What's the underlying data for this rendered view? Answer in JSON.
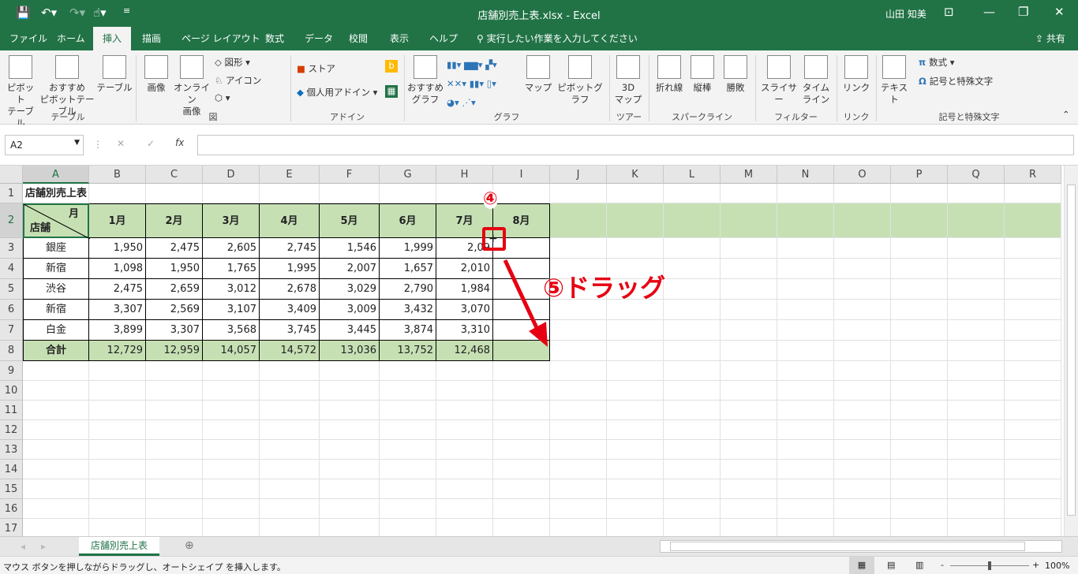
{
  "window": {
    "title": "店舗別売上表.xlsx  -  Excel",
    "user": "山田 知美"
  },
  "tabs": [
    "ファイル",
    "ホーム",
    "挿入",
    "描画",
    "ページ レイアウト",
    "数式",
    "データ",
    "校閲",
    "表示",
    "ヘルプ"
  ],
  "tell_me": "実行したい作業を入力してください",
  "share": "共有",
  "ribbon": {
    "buttons": [
      {
        "l1": "ピボット",
        "l2": "テーブル"
      },
      {
        "l1": "おすすめ",
        "l2": "ピボットテーブル"
      },
      {
        "l1": "テーブル",
        "l2": ""
      },
      {
        "l1": "画像",
        "l2": ""
      },
      {
        "l1": "オンライン",
        "l2": "画像"
      },
      {
        "l1": "おすすめ",
        "l2": "グラフ"
      },
      {
        "l1": "マップ",
        "l2": ""
      },
      {
        "l1": "ピボットグラフ",
        "l2": ""
      },
      {
        "l1": "3D",
        "l2": "マップ"
      },
      {
        "l1": "折れ線",
        "l2": ""
      },
      {
        "l1": "縦棒",
        "l2": ""
      },
      {
        "l1": "勝敗",
        "l2": ""
      },
      {
        "l1": "スライサー",
        "l2": ""
      },
      {
        "l1": "タイム",
        "l2": "ライン"
      },
      {
        "l1": "リンク",
        "l2": ""
      },
      {
        "l1": "テキスト",
        "l2": ""
      }
    ],
    "small": {
      "shapes": "図形",
      "icons": "アイコン",
      "store": "ストア",
      "addins": "個人用アドイン",
      "equation": "数式",
      "symbol": "記号と特殊文字"
    },
    "groups": [
      "テーブル",
      "図",
      "アドイン",
      "グラフ",
      "ツアー",
      "スパークライン",
      "フィルター",
      "リンク",
      "記号と特殊文字"
    ]
  },
  "formula": {
    "namebox": "A2",
    "value": ""
  },
  "columns": [
    "A",
    "B",
    "C",
    "D",
    "E",
    "F",
    "G",
    "H",
    "I",
    "J",
    "K",
    "L",
    "M",
    "N",
    "O",
    "P",
    "Q",
    "R"
  ],
  "rows": [
    "1",
    "2",
    "3",
    "4",
    "5",
    "6",
    "7",
    "8",
    "9",
    "10",
    "11",
    "12",
    "13",
    "14",
    "15",
    "16",
    "17"
  ],
  "sheet": {
    "title": "店舗別売上表",
    "corner_month": "月",
    "corner_store": "店舗",
    "months": [
      "1月",
      "2月",
      "3月",
      "4月",
      "5月",
      "6月",
      "7月",
      "8月"
    ],
    "stores": [
      {
        "name": "銀座",
        "values": [
          "1,950",
          "2,475",
          "2,605",
          "2,745",
          "1,546",
          "1,999",
          "2,09"
        ]
      },
      {
        "name": "新宿",
        "values": [
          "1,098",
          "1,950",
          "1,765",
          "1,995",
          "2,007",
          "1,657",
          "2,010"
        ]
      },
      {
        "name": "渋谷",
        "values": [
          "2,475",
          "2,659",
          "3,012",
          "2,678",
          "3,029",
          "2,790",
          "1,984"
        ]
      },
      {
        "name": "新宿",
        "values": [
          "3,307",
          "2,569",
          "3,107",
          "3,409",
          "3,009",
          "3,432",
          "3,070"
        ]
      },
      {
        "name": "白金",
        "values": [
          "3,899",
          "3,307",
          "3,568",
          "3,745",
          "3,445",
          "3,874",
          "3,310"
        ]
      }
    ],
    "total": {
      "name": "合計",
      "values": [
        "12,729",
        "12,959",
        "14,057",
        "14,572",
        "13,036",
        "13,752",
        "12,468"
      ]
    }
  },
  "annotations": {
    "step4": "④",
    "step5": "⑤ドラッグ"
  },
  "sheet_tab": "店舗別売上表",
  "status": {
    "message": "マウス ボタンを押しながらドラッグし、オートシェイプ を挿入します。",
    "zoom": "100%"
  },
  "colors": {
    "excel_green": "#217346",
    "header_fill": "#c6e0b4",
    "annotation": "#e60012"
  }
}
